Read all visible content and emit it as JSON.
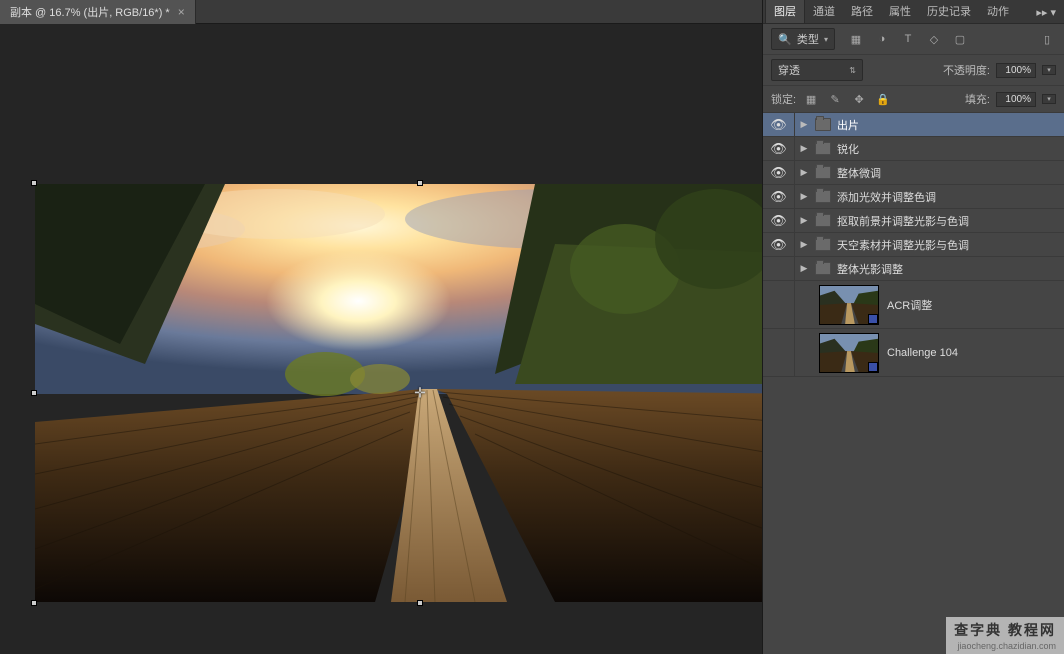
{
  "document": {
    "tab_title": "副本 @ 16.7% (出片, RGB/16*) *"
  },
  "panel": {
    "tabs": [
      "图层",
      "通道",
      "路径",
      "属性",
      "历史记录",
      "动作"
    ],
    "active_tab_index": 0,
    "filter_label": "类型",
    "blend_mode": "穿透",
    "opacity_label": "不透明度:",
    "opacity_value": "100%",
    "lock_label": "锁定:",
    "fill_label": "填充:",
    "fill_value": "100%"
  },
  "layers": [
    {
      "type": "group",
      "name": "出片",
      "eye": true,
      "selected": true
    },
    {
      "type": "group",
      "name": "锐化",
      "eye": true,
      "selected": false
    },
    {
      "type": "group",
      "name": "整体微调",
      "eye": true,
      "selected": false
    },
    {
      "type": "group",
      "name": "添加光效并调整色调",
      "eye": true,
      "selected": false
    },
    {
      "type": "group",
      "name": "抠取前景并调整光影与色调",
      "eye": true,
      "selected": false
    },
    {
      "type": "group",
      "name": "天空素材并调整光影与色调",
      "eye": true,
      "selected": false
    },
    {
      "type": "group",
      "name": "整体光影调整",
      "eye": false,
      "selected": false
    },
    {
      "type": "image",
      "name": "ACR调整",
      "eye": false,
      "selected": false,
      "badge": true
    },
    {
      "type": "image",
      "name": "Challenge 104",
      "eye": false,
      "selected": false,
      "badge": true
    }
  ],
  "watermark": {
    "cn": "查字典 教程网",
    "en": "jiaocheng.chazidian.com"
  }
}
